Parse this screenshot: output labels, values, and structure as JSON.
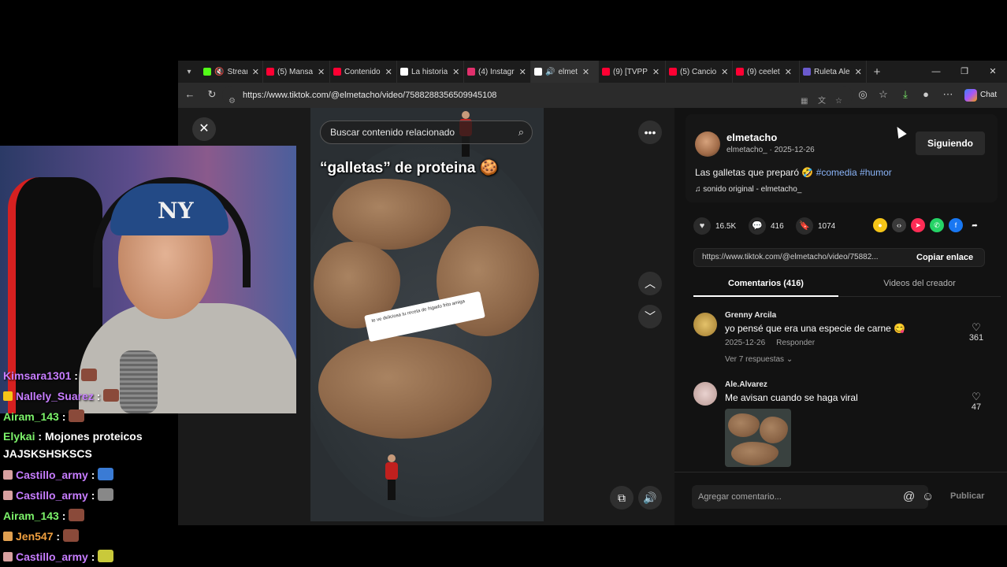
{
  "browser": {
    "tabs": [
      {
        "label": "Stream",
        "color": "#53fc18",
        "active": false
      },
      {
        "label": "(5) Mansa",
        "color": "#ff0033",
        "active": false
      },
      {
        "label": "Contenido",
        "color": "#ff0033",
        "active": false
      },
      {
        "label": "La historia",
        "color": "#ffffff",
        "active": false
      },
      {
        "label": "(4) Instagr",
        "color": "#e1306c",
        "active": false
      },
      {
        "label": "elmet",
        "color": "#ffffff",
        "active": true
      },
      {
        "label": "(9) [TVPP",
        "color": "#ff0033",
        "active": false
      },
      {
        "label": "(5) Cancio",
        "color": "#ff0033",
        "active": false
      },
      {
        "label": "(9) ceelet",
        "color": "#ff0033",
        "active": false
      },
      {
        "label": "Ruleta Ale",
        "color": "#6a5acd",
        "active": false
      }
    ],
    "url": "https://www.tiktok.com/@elmetacho/video/7588288356509945108",
    "chat_label": "Chat"
  },
  "video": {
    "search_placeholder": "Buscar contenido relacionado",
    "caption": "“galletas” de proteina",
    "sticker_text": "te ve deliciosa tu receta de higado frito amiga"
  },
  "author": {
    "name": "elmetacho",
    "sub": "elmetacho_ · 2025-12-26",
    "follow_label": "Siguiendo",
    "desc_text": "Las galletas que preparó",
    "tags": [
      "#comedia",
      "#humor"
    ],
    "sound": "sonido original - elmetacho_"
  },
  "stats": {
    "likes": "16.5K",
    "comments": "416",
    "saves": "1074"
  },
  "link": {
    "text": "https://www.tiktok.com/@elmetacho/video/75882...",
    "copy_label": "Copiar enlace"
  },
  "panel_tabs": {
    "comments": "Comentarios (416)",
    "videos": "Videos del creador"
  },
  "comments": [
    {
      "user": "Grenny Arcila",
      "text": "yo pensé que era una especie de carne",
      "date": "2025-12-26",
      "reply": "Responder",
      "likes": "361",
      "replies": "Ver 7 respuestas"
    },
    {
      "user": "Ale.Alvarez",
      "text": "Me avisan cuando se haga viral",
      "likes": "47"
    }
  ],
  "comment_box": {
    "placeholder": "Agregar comentario...",
    "publish": "Publicar"
  },
  "stream_chat": [
    {
      "user": "Kimsara1301",
      "text": "",
      "color": "purple"
    },
    {
      "user": "Nallely_Suarez",
      "text": "",
      "color": "purple"
    },
    {
      "user": "Airam_143",
      "text": "",
      "color": "green"
    },
    {
      "user": "Elykai",
      "text": "Mojones proteicos",
      "color": "green"
    },
    {
      "user": "",
      "text": "JAJSKSHSKSCS",
      "color": "green"
    },
    {
      "user": "Castillo_army",
      "text": "",
      "color": "purple"
    },
    {
      "user": "Castillo_army",
      "text": "",
      "color": "purple"
    },
    {
      "user": "Airam_143",
      "text": "",
      "color": "green"
    },
    {
      "user": "Jen547",
      "text": "",
      "color": "orange"
    },
    {
      "user": "Castillo_army",
      "text": "",
      "color": "purple"
    }
  ]
}
